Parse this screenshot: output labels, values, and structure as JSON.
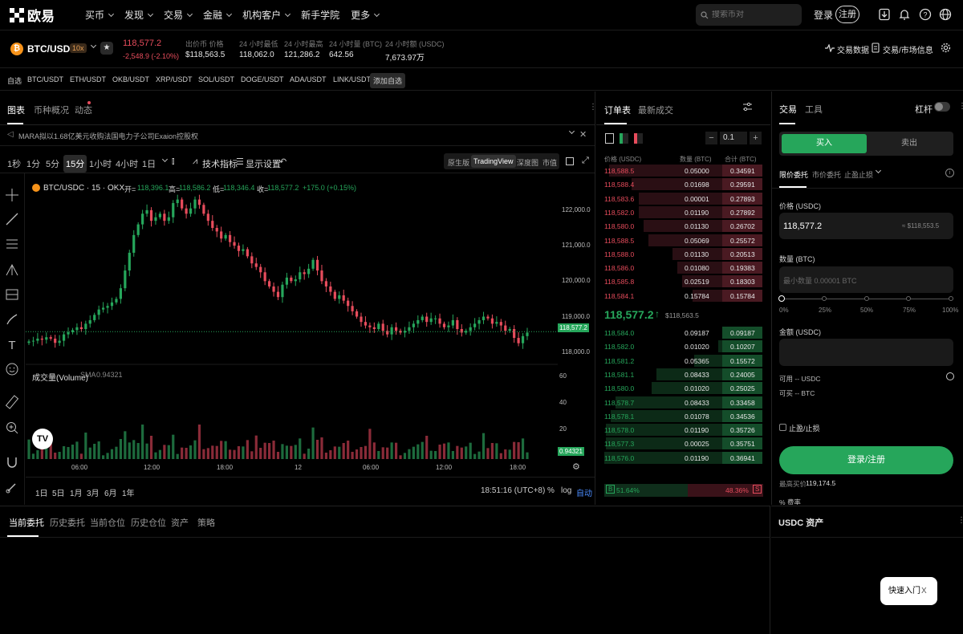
{
  "brand": {
    "name": "欧易"
  },
  "nav": {
    "items": [
      "买币",
      "发现",
      "交易",
      "金融",
      "机构客户",
      "新手学院",
      "更多"
    ],
    "search_placeholder": "搜索币对",
    "login": "登录",
    "signup": "注册"
  },
  "ticker": {
    "pair": "BTC/USDC",
    "leverage": "10x",
    "coin_letter": "₿",
    "price": "118,577.2",
    "change": "-2,548.9 (-2.10%)",
    "stats": [
      {
        "label": "出价币 价格",
        "value": "$118,563.5"
      },
      {
        "label": "24 小时最低",
        "value": "118,062.0"
      },
      {
        "label": "24 小时最高",
        "value": "121,286.2"
      },
      {
        "label": "24 小时量 (BTC)",
        "value": "642.56"
      },
      {
        "label": "24 小时额 (USDC)",
        "value": "7,673.97万"
      }
    ],
    "trade_data": "交易数据",
    "market_info": "交易/市场信息"
  },
  "favorites": {
    "label": "自选",
    "items": [
      "BTC/USDT",
      "ETH/USDT",
      "OKB/USDT",
      "XRP/USDT",
      "SOL/USDT",
      "DOGE/USDT",
      "ADA/USDT",
      "LINK/USDT"
    ],
    "add": "添加自选"
  },
  "chart_tabs": [
    "图表",
    "币种概况",
    "动态"
  ],
  "news": "MARA拟以1.68亿美元收购法国电力子公司Exaion控股权",
  "timeframes": [
    "1秒",
    "1分",
    "5分",
    "15分",
    "1小时",
    "4小时",
    "1日"
  ],
  "toolbar": {
    "indicators": "技术指标",
    "display": "显示设置",
    "views": [
      "原生版",
      "TradingView",
      "深度图",
      "市值"
    ]
  },
  "chart_legend": {
    "symbol": "BTC/USDC · 15 · OKX",
    "o_label": "开=",
    "o": "118,396.1",
    "h_label": "高=",
    "h": "118,586.2",
    "l_label": "低=",
    "l": "118,346.4",
    "c_label": "收=",
    "c": "118,577.2",
    "chg": "+175.0 (+0.15%)"
  },
  "volume_legend": {
    "title": "成交量(Volume)",
    "sma_label": "SMA",
    "sma": "0.94321",
    "last": "0.94321"
  },
  "chart_data": {
    "type": "candlestick",
    "price_ticks": [
      "122,000.0",
      "121,000.0",
      "120,000.0",
      "119,000.0",
      "118,000.0"
    ],
    "volume_ticks": [
      "60",
      "40",
      "20"
    ],
    "x_ticks": [
      "06:00",
      "12:00",
      "18:00",
      "12",
      "06:00",
      "12:00",
      "18:00"
    ],
    "last_price": "118,577.2",
    "ylim": [
      117700,
      122450
    ],
    "close": [
      118300,
      118320,
      118380,
      118350,
      118420,
      118380,
      118260,
      118320,
      118500,
      118560,
      118620,
      118700,
      118650,
      118800,
      118900,
      119050,
      119200,
      119250,
      119300,
      119400,
      119500,
      119800,
      120300,
      120800,
      121300,
      121600,
      121900,
      122000,
      121700,
      121800,
      121900,
      121700,
      121800,
      122200,
      122300,
      122050,
      121900,
      122050,
      122300,
      122150,
      121900,
      121700,
      121500,
      121400,
      121200,
      121300,
      121100,
      121000,
      120850,
      120900,
      120700,
      120500,
      120400,
      120250,
      120000,
      119850,
      119700,
      119550,
      119900,
      120100,
      120000,
      120050,
      120250,
      120200,
      120350,
      120600,
      120300,
      120000,
      119850,
      119700,
      119500,
      119600,
      119450,
      119300,
      119150,
      119000,
      118850,
      118750,
      118700,
      118650,
      118800,
      118600,
      118500,
      118700,
      118600,
      118550,
      118600,
      118700,
      118800,
      118900,
      119000,
      118850,
      118950,
      118950,
      118800,
      118700,
      118750,
      118900,
      118650,
      118550,
      118600,
      118700,
      118800,
      118900,
      119000,
      118950,
      118800,
      118850,
      118750,
      118600,
      118650,
      118400,
      118250,
      118450,
      118550
    ]
  },
  "bottom_tools": {
    "ranges": [
      "1日",
      "5日",
      "1月",
      "3月",
      "6月",
      "1年"
    ],
    "time": "18:51:16 (UTC+8)",
    "pct": "%",
    "log": "log",
    "auto": "自动"
  },
  "orderbook": {
    "tabs": [
      "订单表",
      "最新成交"
    ],
    "step": "0.1",
    "headers": [
      "价格 (USDC)",
      "数量 (BTC)",
      "合计 (BTC)"
    ],
    "asks": [
      {
        "price": "118,588.5",
        "qty": "0.05000",
        "total": "0.34591",
        "depth": 0.97
      },
      {
        "price": "118,588.4",
        "qty": "0.01698",
        "total": "0.29591",
        "depth": 0.83
      },
      {
        "price": "118,583.6",
        "qty": "0.00001",
        "total": "0.27893",
        "depth": 0.78
      },
      {
        "price": "118,582.0",
        "qty": "0.01190",
        "total": "0.27892",
        "depth": 0.78
      },
      {
        "price": "118,580.0",
        "qty": "0.01130",
        "total": "0.26702",
        "depth": 0.75
      },
      {
        "price": "118,588.5",
        "qty": "0.05069",
        "total": "0.25572",
        "depth": 0.72
      },
      {
        "price": "118,588.0",
        "qty": "0.01130",
        "total": "0.20513",
        "depth": 0.57
      },
      {
        "price": "118,586.0",
        "qty": "0.01080",
        "total": "0.19383",
        "depth": 0.54
      },
      {
        "price": "118,585.8",
        "qty": "0.02519",
        "total": "0.18303",
        "depth": 0.51
      },
      {
        "price": "118,584.1",
        "qty": "0.15784",
        "total": "0.15784",
        "depth": 0.44
      }
    ],
    "mid_price": "118,577.2",
    "mid_arrow": "↑",
    "mid_usd": "$118,563.5",
    "bids": [
      {
        "price": "118,584.0",
        "qty": "0.09187",
        "total": "0.09187",
        "depth": 0.25
      },
      {
        "price": "118,582.0",
        "qty": "0.01020",
        "total": "0.10207",
        "depth": 0.28
      },
      {
        "price": "118,581.2",
        "qty": "0.05365",
        "total": "0.15572",
        "depth": 0.43
      },
      {
        "price": "118,581.1",
        "qty": "0.08433",
        "total": "0.24005",
        "depth": 0.67
      },
      {
        "price": "118,580.0",
        "qty": "0.01020",
        "total": "0.25025",
        "depth": 0.7
      },
      {
        "price": "118,578.7",
        "qty": "0.08433",
        "total": "0.33458",
        "depth": 0.93
      },
      {
        "price": "118,578.1",
        "qty": "0.01078",
        "total": "0.34536",
        "depth": 0.96
      },
      {
        "price": "118,578.0",
        "qty": "0.01190",
        "total": "0.35726",
        "depth": 0.99
      },
      {
        "price": "118,577.3",
        "qty": "0.00025",
        "total": "0.35751",
        "depth": 0.99
      },
      {
        "price": "118,576.0",
        "qty": "0.01190",
        "total": "0.36941",
        "depth": 1.0
      }
    ],
    "buy_pct": "51.64%",
    "sell_pct": "48.36%",
    "b": "B",
    "s": "S"
  },
  "trade": {
    "tabs": [
      "交易",
      "工具"
    ],
    "leverage": "杠杆",
    "buy": "买入",
    "sell": "卖出",
    "order_types": [
      "限价委托",
      "市价委托",
      "止盈止损"
    ],
    "price_label": "价格 (USDC)",
    "price": "118,577.2",
    "price_usd": "≈ $118,553.5",
    "qty_label": "数量 (BTC)",
    "qty_placeholder": "最小数量 0.00001 BTC",
    "slider": [
      "0%",
      "25%",
      "50%",
      "75%",
      "100%"
    ],
    "amount_label": "金额 (USDC)",
    "avail_usdc": "可用 -- USDC",
    "avail_btc": "可买 -- BTC",
    "tpsl": "止盈/止损",
    "cta": "登录/注册",
    "ref_label": "最高买价",
    "ref_price": "119,174.5",
    "fee": "% 费率"
  },
  "bottom": {
    "tabs": [
      "当前委托",
      "历史委托",
      "当前仓位",
      "历史仓位",
      "资产",
      "策略"
    ]
  },
  "assets": {
    "title": "USDC 资产"
  },
  "quick": {
    "label": "快速入门",
    "close": "X"
  }
}
